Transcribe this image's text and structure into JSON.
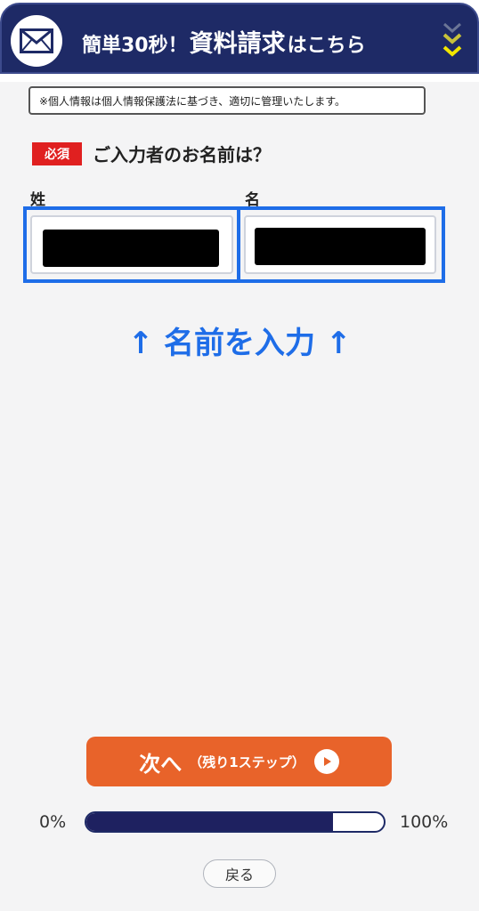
{
  "colors": {
    "header_bg": "#1e2a66",
    "accent_blue": "#1e6de8",
    "required_red": "#e02020",
    "next_orange": "#e8632a",
    "progress_fill": "#1e2160",
    "chevron_yellow": "#f2e600"
  },
  "header": {
    "icon": "mail-icon",
    "title_prefix": "簡単30秒！",
    "title_main": "資料請求",
    "title_suffix": "はこちら",
    "expand_icon": "double-chevron-down-icon"
  },
  "notice": "※個人情報は個人情報保護法に基づき、適切に管理いたします。",
  "question": {
    "required_badge": "必須",
    "text": "ご入力者のお名前は？"
  },
  "fields": {
    "last_name_label": "姓",
    "first_name_label": "名",
    "last_name_value": "",
    "first_name_value": ""
  },
  "hint": "↑ 名前を入力 ↑",
  "next_button": {
    "label": "次へ",
    "sub_label": "（残り1ステップ）",
    "icon": "play-circle-icon"
  },
  "progress": {
    "start_label": "0%",
    "end_label": "100%",
    "value_percent": 83
  },
  "back_button": "戻る"
}
